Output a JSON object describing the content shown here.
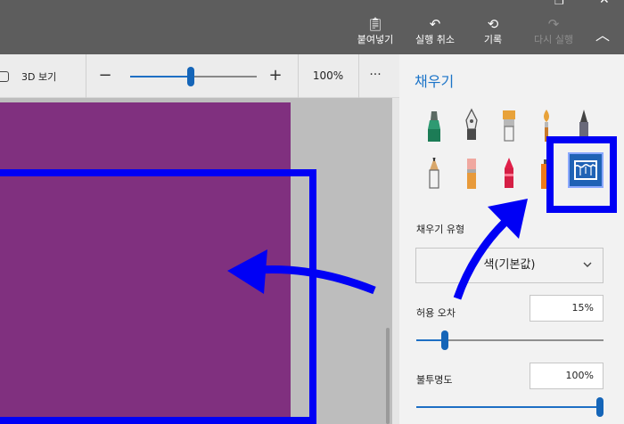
{
  "commands": {
    "paste_label": "붙여넣기",
    "undo_label": "실행 취소",
    "history_label": "기록",
    "redo_label": "다시 실행"
  },
  "viewbar": {
    "view3d_label": "3D 보기",
    "zoom_percent": "100%",
    "zoom_level": 0.48,
    "more_label": "···"
  },
  "panel": {
    "title": "채우기",
    "fill_type_label": "채우기 유형",
    "fill_type_value": "색(기본값)",
    "tolerance_label": "허용 오차",
    "tolerance_value": "15%",
    "tolerance_level": 0.15,
    "opacity_label": "불투명도",
    "opacity_value": "100%",
    "opacity_level": 1.0
  },
  "tools": [
    "marker-icon",
    "calligraphy-pen-icon",
    "oil-brush-icon",
    "watercolor-icon",
    "pixel-pen-icon",
    "pencil-icon",
    "eraser-icon",
    "crayon-icon",
    "spray-can-icon",
    "fill-bucket-icon"
  ],
  "colors": {
    "accent": "#1a73c8",
    "canvas_fill": "#80307f",
    "annotation": "#0000f5",
    "titlebar": "#5d5d5d"
  }
}
